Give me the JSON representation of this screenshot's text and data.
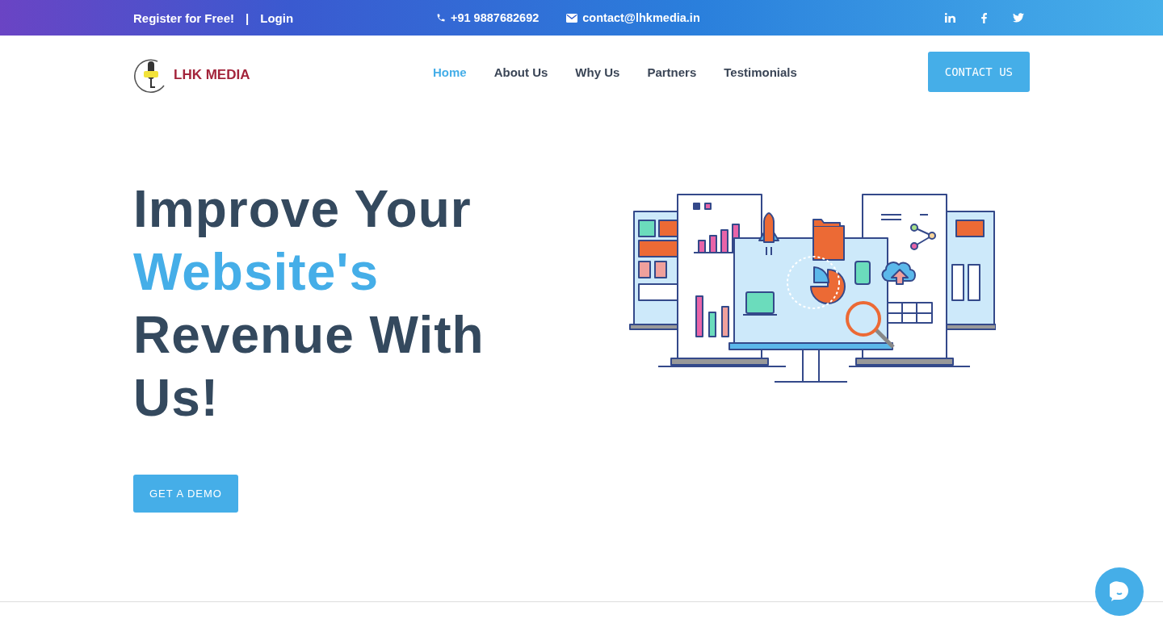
{
  "top_bar": {
    "links": [
      {
        "label": "Register for Free!"
      },
      {
        "label": "Login"
      }
    ],
    "separator": "|",
    "phone": "+91 9887682692",
    "email": "contact@lhkmedia.in",
    "social": [
      {
        "kind": "linkedin"
      },
      {
        "kind": "facebook"
      },
      {
        "kind": "twitter"
      }
    ]
  },
  "header": {
    "logo_text": "LHK MEDIA",
    "nav": [
      {
        "label": "Home",
        "selected": true
      },
      {
        "label": "About Us",
        "selected": false
      },
      {
        "label": "Why Us",
        "selected": false
      },
      {
        "label": "Partners",
        "selected": false
      },
      {
        "label": "Testimonials",
        "selected": false
      }
    ],
    "cta": "CONTACT US"
  },
  "hero": {
    "headline": [
      {
        "text": "Improve Your",
        "highlight": false
      },
      {
        "text": "Website's",
        "highlight": true
      },
      {
        "text": "Revenue With Us!",
        "highlight": false
      }
    ],
    "button": "GET A DEMO"
  }
}
